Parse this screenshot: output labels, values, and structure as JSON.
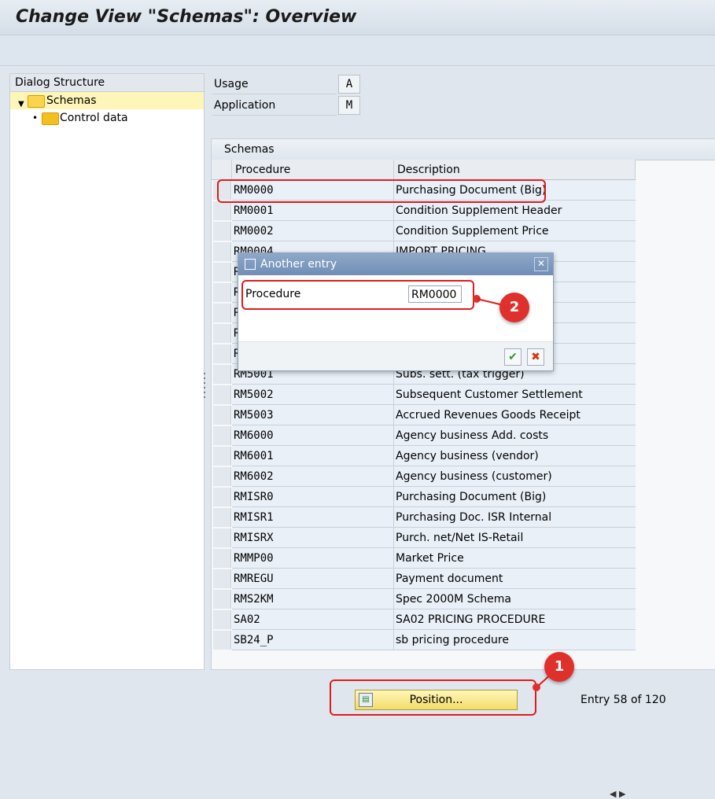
{
  "window": {
    "title": "Change View \"Schemas\": Overview"
  },
  "dialog_structure": {
    "header": "Dialog Structure",
    "items": [
      {
        "label": "Schemas"
      },
      {
        "label": "Control data"
      }
    ]
  },
  "fields": {
    "usage": {
      "label": "Usage",
      "value": "A"
    },
    "application": {
      "label": "Application",
      "value": "M"
    }
  },
  "table": {
    "title": "Schemas",
    "columns": [
      "Procedure",
      "Description"
    ],
    "rows": [
      {
        "procedure": "RM0000",
        "description": "Purchasing Document (Big)"
      },
      {
        "procedure": "RM0001",
        "description": "Condition Supplement Header"
      },
      {
        "procedure": "RM0002",
        "description": "Condition Supplement Price"
      },
      {
        "procedure": "RM0004",
        "description": "IMPORT PRICING"
      },
      {
        "procedure": "R",
        "description": ""
      },
      {
        "procedure": "R",
        "description": ""
      },
      {
        "procedure": "R",
        "description": ""
      },
      {
        "procedure": "R",
        "description": ""
      },
      {
        "procedure": "R",
        "description": ""
      },
      {
        "procedure": "RM5001",
        "description": "Subs. sett. (tax trigger)"
      },
      {
        "procedure": "RM5002",
        "description": "Subsequent Customer Settlement"
      },
      {
        "procedure": "RM5003",
        "description": "Accrued Revenues Goods Receipt"
      },
      {
        "procedure": "RM6000",
        "description": "Agency business Add. costs"
      },
      {
        "procedure": "RM6001",
        "description": "Agency business (vendor)"
      },
      {
        "procedure": "RM6002",
        "description": "Agency business (customer)"
      },
      {
        "procedure": "RMISR0",
        "description": "Purchasing Document (Big)"
      },
      {
        "procedure": "RMISR1",
        "description": "Purchasing Doc. ISR Internal"
      },
      {
        "procedure": "RMISRX",
        "description": "Purch. net/Net IS-Retail"
      },
      {
        "procedure": "RMMP00",
        "description": "Market Price"
      },
      {
        "procedure": "RMREGU",
        "description": "Payment document"
      },
      {
        "procedure": "RMS2KM",
        "description": "Spec 2000M Schema"
      },
      {
        "procedure": "SA02",
        "description": "SA02 PRICING PROCEDURE"
      },
      {
        "procedure": "SB24_P",
        "description": "sb pricing procedure"
      }
    ]
  },
  "dialog": {
    "title": "Another entry",
    "field_label": "Procedure",
    "field_value": "RM0000",
    "close_glyph": "✕",
    "confirm_glyph": "✔",
    "cancel_glyph": "✖"
  },
  "footer": {
    "position_button": "Position...",
    "entry_info": "Entry 58 of 120"
  },
  "callouts": {
    "one": "1",
    "two": "2"
  },
  "colors": {
    "annotation_red": "#e01c1c",
    "selected_row": "#fdf6b8",
    "button_yellow": "#f2dc6a"
  }
}
